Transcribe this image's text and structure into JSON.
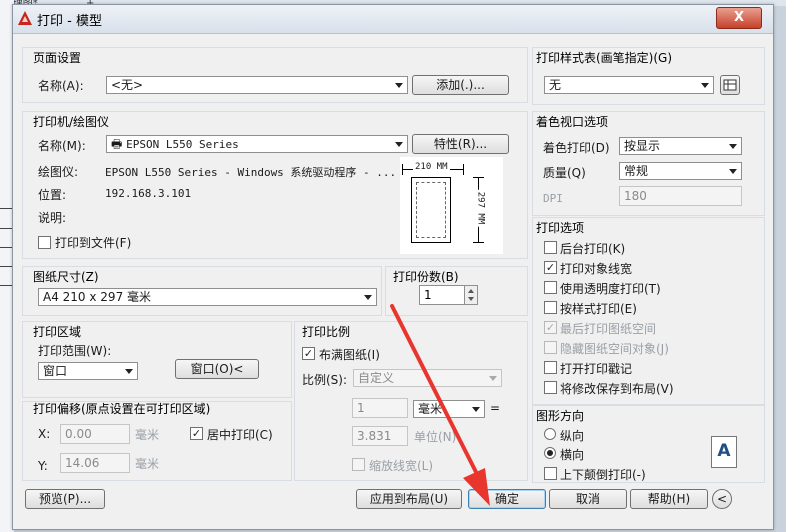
{
  "background_tab": "l原理图*",
  "title": "打印 - 模型",
  "close_glyph": "X",
  "page_setup": {
    "group_label": "页面设置",
    "name_label": "名称(A):",
    "name_value": "<无>",
    "add_button": "添加(.)..."
  },
  "printer": {
    "group_label": "打印机/绘图仪",
    "name_label": "名称(M):",
    "name_value": "EPSON L550 Series",
    "properties_button": "特性(R)...",
    "plotter_label": "绘图仪:",
    "plotter_value": "EPSON L550 Series - Windows 系统驱动程序 - ...",
    "location_label": "位置:",
    "location_value": "192.168.3.101",
    "description_label": "说明:",
    "print_to_file": "打印到文件(F)",
    "preview_width": "210 MM",
    "preview_height": "297 MM"
  },
  "paper_size": {
    "group_label": "图纸尺寸(Z)",
    "value": "A4 210 x 297 毫米"
  },
  "copies": {
    "group_label": "打印份数(B)",
    "value": "1"
  },
  "plot_area": {
    "group_label": "打印区域",
    "range_label": "打印范围(W):",
    "range_value": "窗口",
    "window_button": "窗口(O)<"
  },
  "plot_scale": {
    "group_label": "打印比例",
    "fit_paper": "布满图纸(I)",
    "scale_label": "比例(S):",
    "scale_value": "自定义",
    "value1": "1",
    "unit_value": "毫米",
    "equals": "=",
    "value2": "3.831",
    "unit_label": "单位(N)",
    "scale_lineweights": "缩放线宽(L)"
  },
  "plot_offset": {
    "group_label": "打印偏移(原点设置在可打印区域)",
    "x_label": "X:",
    "x_value": "0.00",
    "y_label": "Y:",
    "y_value": "14.06",
    "unit": "毫米",
    "center_plot": "居中打印(C)"
  },
  "plot_style_table": {
    "group_label": "打印样式表(画笔指定)(G)",
    "value": "无"
  },
  "shaded_viewport": {
    "group_label": "着色视口选项",
    "shade_label": "着色打印(D)",
    "shade_value": "按显示",
    "quality_label": "质量(Q)",
    "quality_value": "常规",
    "dpi_label": "DPI",
    "dpi_value": "180"
  },
  "plot_options": {
    "group_label": "打印选项",
    "items": [
      {
        "label": "后台打印(K)",
        "checked": false,
        "disabled": false
      },
      {
        "label": "打印对象线宽",
        "checked": true,
        "disabled": false
      },
      {
        "label": "使用透明度打印(T)",
        "checked": false,
        "disabled": false
      },
      {
        "label": "按样式打印(E)",
        "checked": false,
        "disabled": false
      },
      {
        "label": "最后打印图纸空间",
        "checked": true,
        "disabled": true
      },
      {
        "label": "隐藏图纸空间对象(J)",
        "checked": false,
        "disabled": true
      },
      {
        "label": "打开打印戳记",
        "checked": false,
        "disabled": false
      },
      {
        "label": "将修改保存到布局(V)",
        "checked": false,
        "disabled": false
      }
    ]
  },
  "orientation": {
    "group_label": "图形方向",
    "portrait": "纵向",
    "landscape": "横向",
    "upside_down": "上下颠倒打印(-)",
    "selected": "landscape",
    "paper_glyph": "A"
  },
  "footer": {
    "preview_button": "预览(P)...",
    "apply_button": "应用到布局(U)",
    "ok_button": "确定",
    "cancel_button": "取消",
    "help_button": "帮助(H)"
  },
  "colors": {
    "annotation_arrow": "#e8362f",
    "titlebar": "#dfe6ee",
    "close": "#c7402a",
    "logo": "#c8251d"
  }
}
